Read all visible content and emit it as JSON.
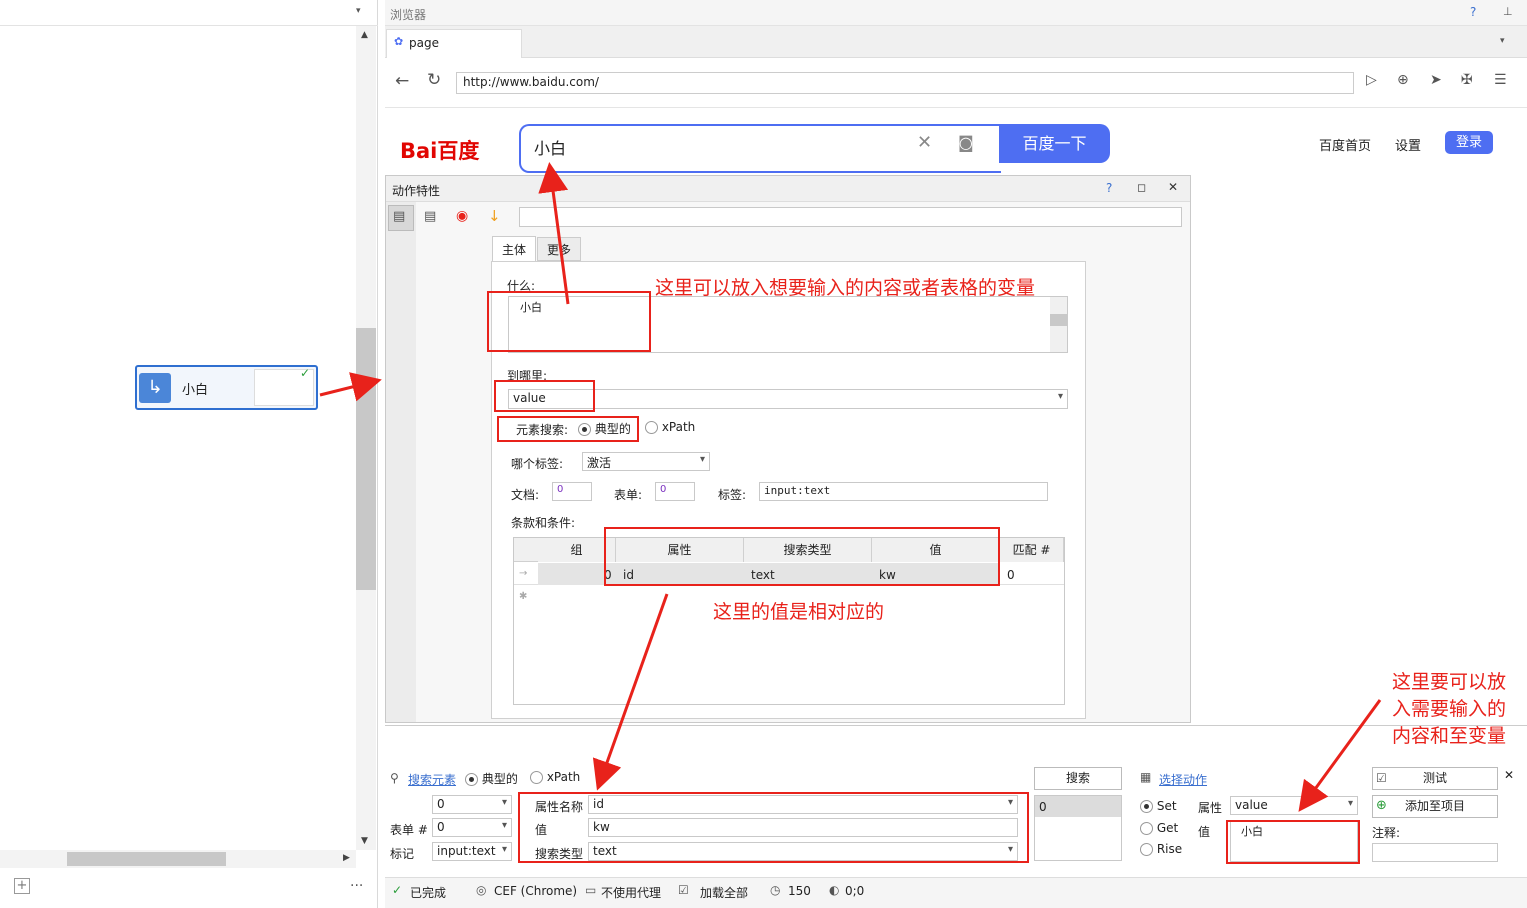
{
  "browser": {
    "title": "浏览器",
    "help": "?",
    "pin": "⊥",
    "tab_label": "page",
    "url": "http://www.baidu.com/"
  },
  "baidu": {
    "logo": "Bai百度",
    "search_value": "小白",
    "submit": "百度一下",
    "links": [
      "百度首页",
      "设置"
    ],
    "login": "登录"
  },
  "node": {
    "label": "小白"
  },
  "dialog": {
    "title": "动作特性",
    "tabs": [
      "主体",
      "更多"
    ],
    "what_label": "什么:",
    "what_value": "小白",
    "where_label": "到哪里:",
    "where_value": "value",
    "element_search_label": "元素搜索:",
    "typical": "典型的",
    "xpath": "xPath",
    "which_tag_label": "哪个标签:",
    "which_tag_value": "激活",
    "doc_label": "文档:",
    "doc_value": "0",
    "form_label": "表单:",
    "form_value": "0",
    "tag_label": "标签:",
    "tag_value": "input:text",
    "conditions_label": "条款和条件:",
    "grid_headers": [
      "组",
      "属性",
      "搜索类型",
      "值",
      "匹配 #"
    ],
    "grid_row": {
      "group": "0",
      "attr": "id",
      "type": "text",
      "value": "kw",
      "match": "0"
    }
  },
  "annotations": {
    "a1": "这里可以放入想要输入的内容或者表格的变量",
    "a2": "这里的值是相对应的",
    "a3_line1": "这里要可以放",
    "a3_line2": "入需要输入的",
    "a3_line3": "内容和至变量"
  },
  "bottom": {
    "search_element": "搜索元素",
    "typical": "典型的",
    "xpath": "xPath",
    "row1_value": "0",
    "form_label": "表单 #",
    "form_value": "0",
    "tag_label": "标记",
    "tag_value": "input:text",
    "attr_name_label": "属性名称",
    "attr_name_value": "id",
    "value_label": "值",
    "value_value": "kw",
    "search_type_label": "搜索类型",
    "search_type_value": "text",
    "search_btn": "搜索",
    "result_value": "0",
    "select_action": "选择动作",
    "set": "Set",
    "get": "Get",
    "rise": "Rise",
    "attr_label": "属性",
    "attr_value": "value",
    "val_label": "值",
    "val_value": "小白",
    "test_btn": "测试",
    "add_btn": "添加至项目",
    "note_label": "注释:"
  },
  "status": {
    "done": "已完成",
    "engine": "CEF (Chrome)",
    "proxy": "不使用代理",
    "load": "加载全部",
    "timeout": "150",
    "coords": "0;0"
  }
}
